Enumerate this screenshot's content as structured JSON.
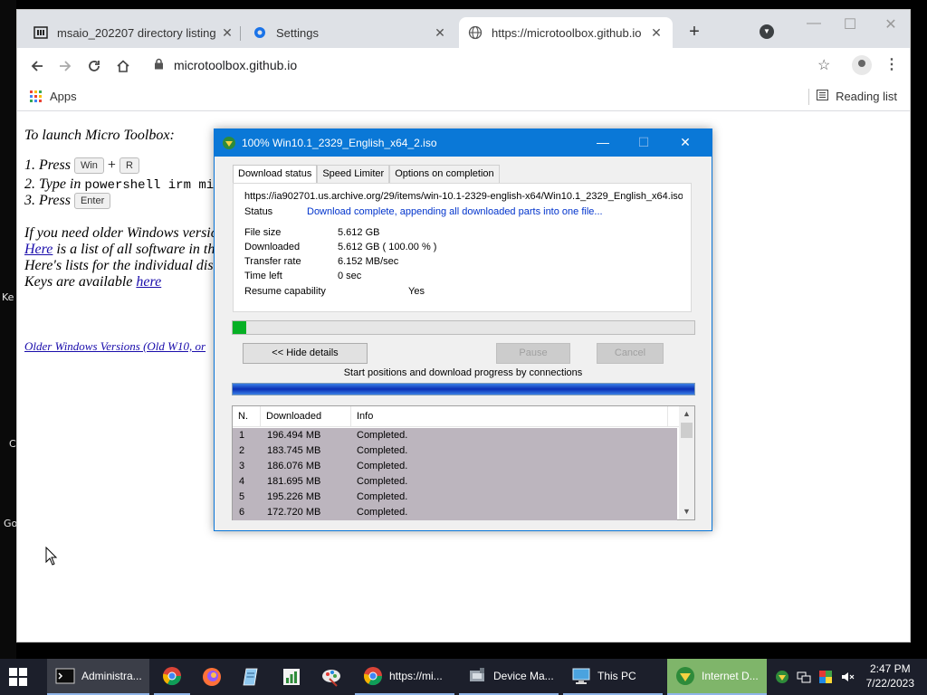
{
  "desktop": {
    "labels": [
      "Ke",
      "C",
      "Go"
    ]
  },
  "browser": {
    "tabs": [
      {
        "title": "msaio_202207 directory listing",
        "icon": "archive-icon",
        "close": "✕"
      },
      {
        "title": "Settings",
        "icon": "gear-icon",
        "close": "✕"
      },
      {
        "title": "https://microtoolbox.github.io",
        "icon": "globe-icon",
        "close": "✕"
      }
    ],
    "new_tab": "+",
    "address": "microtoolbox.github.io",
    "bookmarks": {
      "apps": "Apps",
      "reading_list": "Reading list"
    }
  },
  "page": {
    "line_launch": "To launch Micro Toolbox:",
    "step1_prefix": "1. Press",
    "key_win": "Win",
    "plus": "+",
    "key_r": "R",
    "step2_prefix": "2. Type in",
    "step2_code": "powershell irm micro",
    "step3_prefix": "3. Press",
    "key_enter": "Enter",
    "older_text": "If you need older Windows versic",
    "here1": "Here",
    "list_text": " is a list of all software in th",
    "lists_text": "Here's lists for the individual disc",
    "keys_text": "Keys are available ",
    "here2": "here",
    "older_link": "Older Windows Versions (Old W10, or"
  },
  "dialog": {
    "title": "100% Win10.1_2329_English_x64_2.iso",
    "tabs": [
      "Download status",
      "Speed Limiter",
      "Options on completion"
    ],
    "url": "https://ia902701.us.archive.org/29/items/win-10.1-2329-english-x64/Win10.1_2329_English_x64.iso",
    "status_label": "Status",
    "status_value": "Download complete, appending all downloaded parts into one file...",
    "file_size_label": "File size",
    "file_size_value": "5.612  GB",
    "downloaded_label": "Downloaded",
    "downloaded_value": "5.612  GB  ( 100.00 % )",
    "rate_label": "Transfer rate",
    "rate_value": "6.152  MB/sec",
    "time_left_label": "Time left",
    "time_left_value": "0 sec",
    "resume_label": "Resume capability",
    "resume_value": "Yes",
    "progress_fraction": 0.03,
    "hide_details": "<< Hide details",
    "pause": "Pause",
    "cancel": "Cancel",
    "connections_label": "Start positions and download progress by connections",
    "columns": [
      "N.",
      "Downloaded",
      "Info"
    ],
    "rows": [
      {
        "n": "1",
        "downloaded": "196.494  MB",
        "info": "Completed."
      },
      {
        "n": "2",
        "downloaded": "183.745  MB",
        "info": "Completed."
      },
      {
        "n": "3",
        "downloaded": "186.076  MB",
        "info": "Completed."
      },
      {
        "n": "4",
        "downloaded": "181.695  MB",
        "info": "Completed."
      },
      {
        "n": "5",
        "downloaded": "195.226  MB",
        "info": "Completed."
      },
      {
        "n": "6",
        "downloaded": "172.720  MB",
        "info": "Completed."
      }
    ]
  },
  "taskbar": {
    "items": [
      {
        "label": "Administra...",
        "icon": "terminal-icon"
      },
      {
        "label": "",
        "icon": "chrome-icon"
      },
      {
        "label": "",
        "icon": "firefox-icon"
      },
      {
        "label": "",
        "icon": "notepad-icon"
      },
      {
        "label": "",
        "icon": "spreadsheet-icon"
      },
      {
        "label": "",
        "icon": "paint-icon"
      },
      {
        "label": "https://mi...",
        "icon": "chrome-icon"
      },
      {
        "label": "Device Ma...",
        "icon": "device-manager-icon"
      },
      {
        "label": "This PC",
        "icon": "computer-icon"
      },
      {
        "label": "Internet D...",
        "icon": "idm-icon"
      }
    ],
    "time": "2:47 PM",
    "date": "7/22/2023"
  },
  "colors": {
    "dialog_title": "#0a78d7",
    "progress": "#06b025",
    "status_blue": "#0033cc",
    "taskbar": "#1c1f2b"
  }
}
